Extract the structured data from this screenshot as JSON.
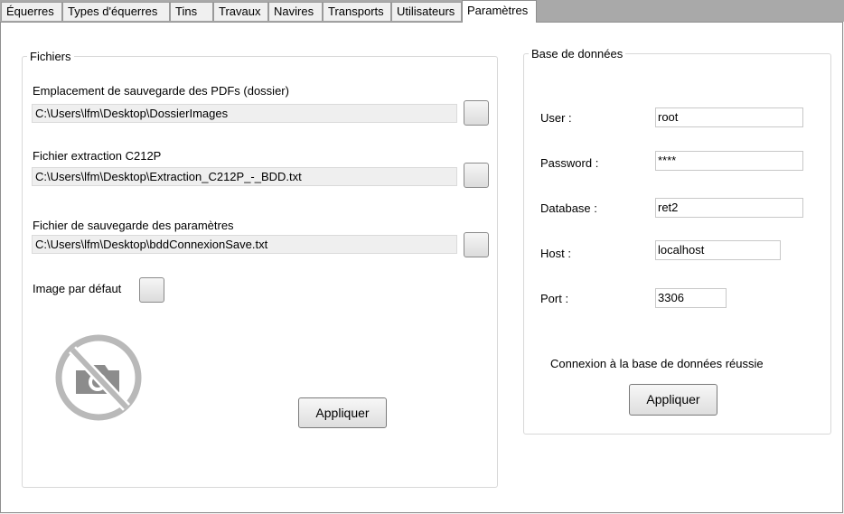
{
  "tabs": [
    {
      "label": "Équerres"
    },
    {
      "label": "Types d'équerres"
    },
    {
      "label": "Tins"
    },
    {
      "label": "Travaux"
    },
    {
      "label": "Navires"
    },
    {
      "label": "Transports"
    },
    {
      "label": "Utilisateurs"
    },
    {
      "label": "Paramètres",
      "active": true
    }
  ],
  "files_group": {
    "title": "Fichiers",
    "pdf_location": {
      "label": "Emplacement de sauvegarde des PDFs (dossier)",
      "value": "C:\\Users\\lfm\\Desktop\\DossierImages"
    },
    "extraction_file": {
      "label": "Fichier extraction C212P",
      "value": "C:\\Users\\lfm\\Desktop\\Extraction_C212P_-_BDD.txt"
    },
    "settings_file": {
      "label": "Fichier de sauvegarde des paramètres",
      "value": "C:\\Users\\lfm\\Desktop\\bddConnexionSave.txt"
    },
    "default_image": {
      "label": "Image par défaut",
      "icon": "no-photo-icon"
    },
    "apply_label": "Appliquer"
  },
  "db_group": {
    "title": "Base de données",
    "user": {
      "label": "User :",
      "value": "root"
    },
    "password": {
      "label": "Password :",
      "value": "****"
    },
    "database": {
      "label": "Database :",
      "value": "ret2"
    },
    "host": {
      "label": "Host :",
      "value": "localhost"
    },
    "port": {
      "label": "Port :",
      "value": "3306"
    },
    "status": "Connexion à la base de données réussie",
    "apply_label": "Appliquer"
  },
  "colors": {
    "tab_strip": "#a9a9a9",
    "icon_gray": "#b9b9b9",
    "camera_gray": "#8c8c8c"
  }
}
